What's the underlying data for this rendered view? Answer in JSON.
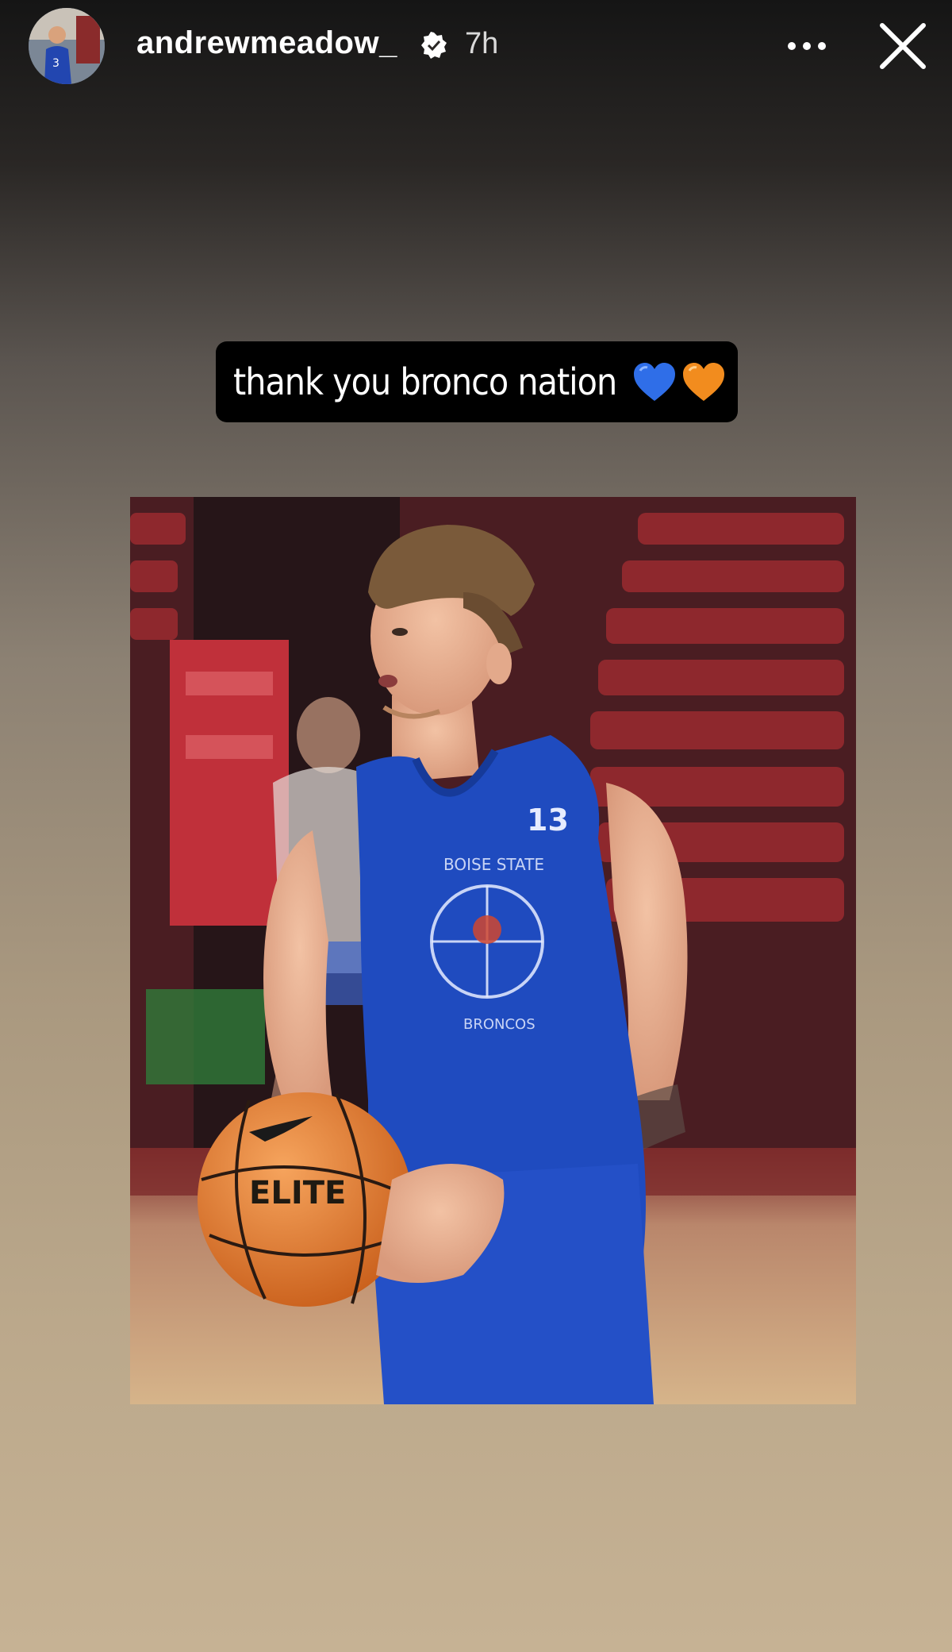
{
  "header": {
    "username": "andrewmeadow_",
    "timestamp": "7h",
    "verified": true,
    "avatar_icon": "avatar-photo",
    "more_icon": "more-horizontal-icon",
    "close_icon": "close-icon"
  },
  "caption": {
    "text": "thank you bronco nation",
    "emojis": [
      "blue-heart",
      "orange-heart"
    ]
  },
  "photo": {
    "description_icon": "basketball-player-photo",
    "jersey_number": "13",
    "jersey_text_top": "BOISE STATE",
    "jersey_text_bottom": "BRONCOS",
    "ball_text": "ELITE"
  },
  "colors": {
    "accent_blue": "#2f5fd0",
    "accent_orange": "#f28c1e",
    "jersey": "#1f4bbf"
  }
}
